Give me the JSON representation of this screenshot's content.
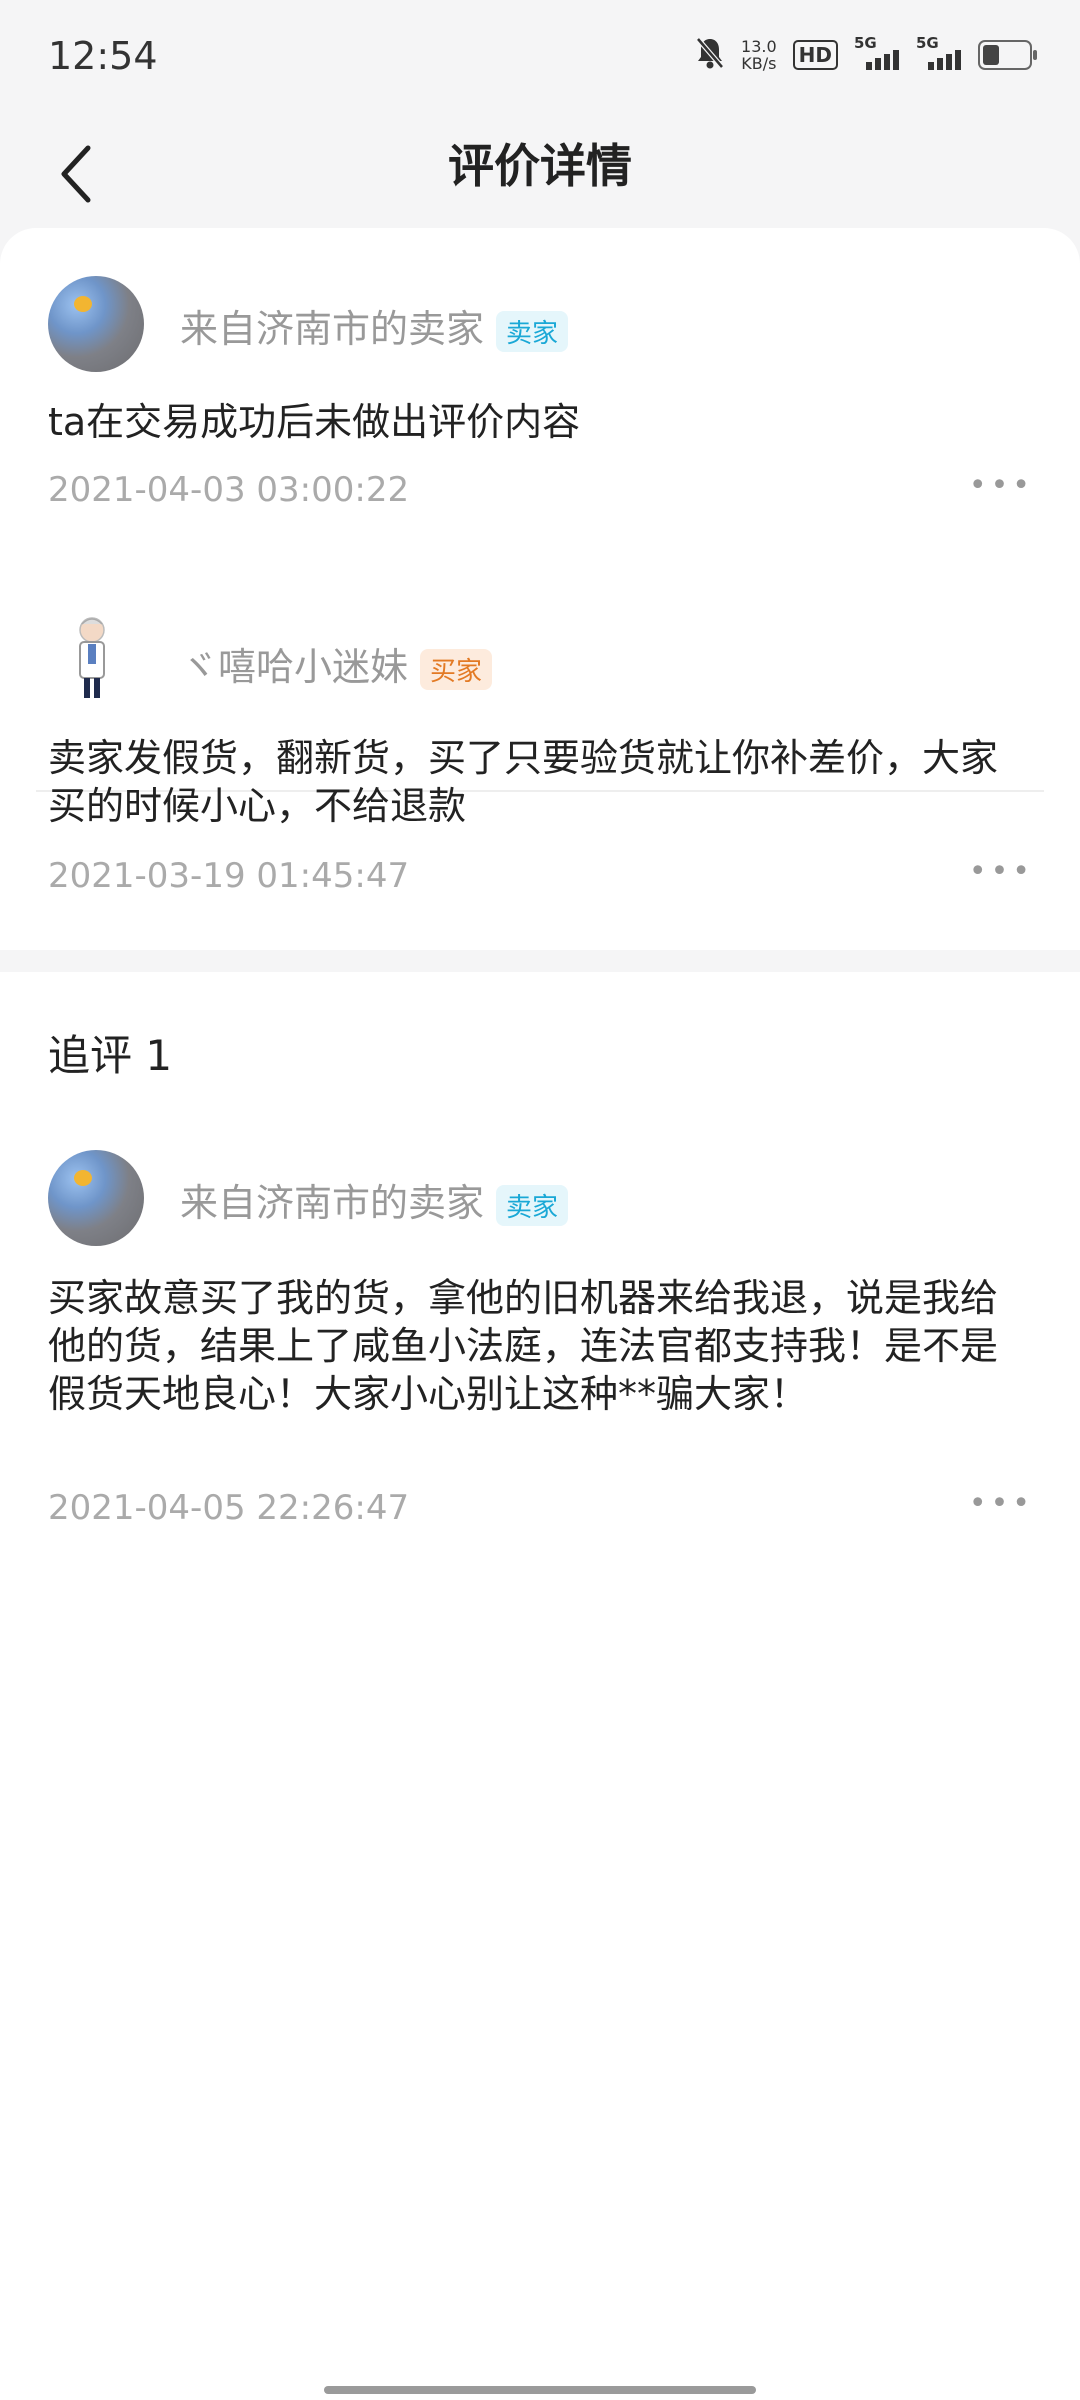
{
  "status_bar": {
    "time": "12:54",
    "net_speed_value": "13.0",
    "net_speed_unit": "KB/s",
    "hd_label": "HD",
    "network_1": "5G",
    "network_2": "5G",
    "icons": [
      "bell-off-icon",
      "hd-icon",
      "signal-icon",
      "signal-icon",
      "battery-icon"
    ]
  },
  "header": {
    "title": "评价详情",
    "back_icon": "chevron-left-icon"
  },
  "reviews": [
    {
      "username": "来自济南市的卖家",
      "role_tag": "卖家",
      "content": "ta在交易成功后未做出评价内容",
      "date": "2021-04-03 03:00:22",
      "more_label": "•••"
    },
    {
      "username": "ヾ嘻哈小迷妹",
      "role_tag": "买家",
      "content": "卖家发假货，翻新货，买了只要验货就让你补差价，大家买的时候小心，不给退款",
      "date": "2021-03-19 01:45:47",
      "more_label": "•••"
    }
  ],
  "followup": {
    "title": "追评 1",
    "username": "来自济南市的卖家",
    "role_tag": "卖家",
    "content": "买家故意买了我的货，拿他的旧机器来给我退，说是我给他的货，结果上了咸鱼小法庭，连法官都支持我！是不是假货天地良心！大家小心别让这种**骗大家！",
    "date": "2021-04-05 22:26:47",
    "more_label": "•••"
  },
  "colors": {
    "seller_tag": "#1aa8d6",
    "buyer_tag": "#e37a24",
    "secondary_text": "#999999",
    "page_bg": "#f5f5f6"
  }
}
